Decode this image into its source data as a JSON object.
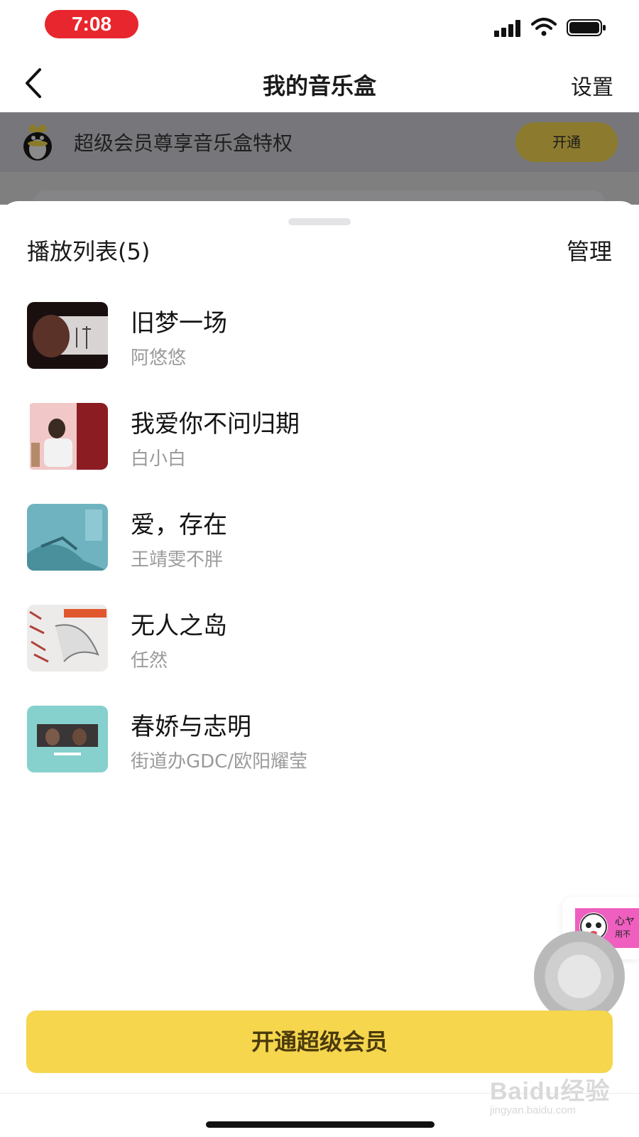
{
  "status_bar": {
    "time": "7:08"
  },
  "nav": {
    "title": "我的音乐盒",
    "settings_label": "设置"
  },
  "promo": {
    "text": "超级会员尊享音乐盒特权",
    "button_label": "开通"
  },
  "sheet": {
    "title": "播放列表(5)",
    "manage_label": "管理",
    "tracks": [
      {
        "title": "旧梦一场",
        "artist": "阿悠悠"
      },
      {
        "title": "我爱你不问归期",
        "artist": "白小白"
      },
      {
        "title": "爱，存在",
        "artist": "王靖雯不胖"
      },
      {
        "title": "无人之岛",
        "artist": "任然"
      },
      {
        "title": "春娇与志明",
        "artist": "街道办GDC/欧阳耀莹"
      }
    ]
  },
  "floating_card": {
    "text_line1": "心ヤ",
    "text_line2": "用不"
  },
  "cta": {
    "label": "开通超级会员"
  },
  "watermark": {
    "logo": "Baidu经验",
    "url": "jingyan.baidu.com"
  },
  "colors": {
    "accent": "#f5d64d",
    "status_time_bg": "#e8262d",
    "cta_text": "#4b3a0c"
  }
}
